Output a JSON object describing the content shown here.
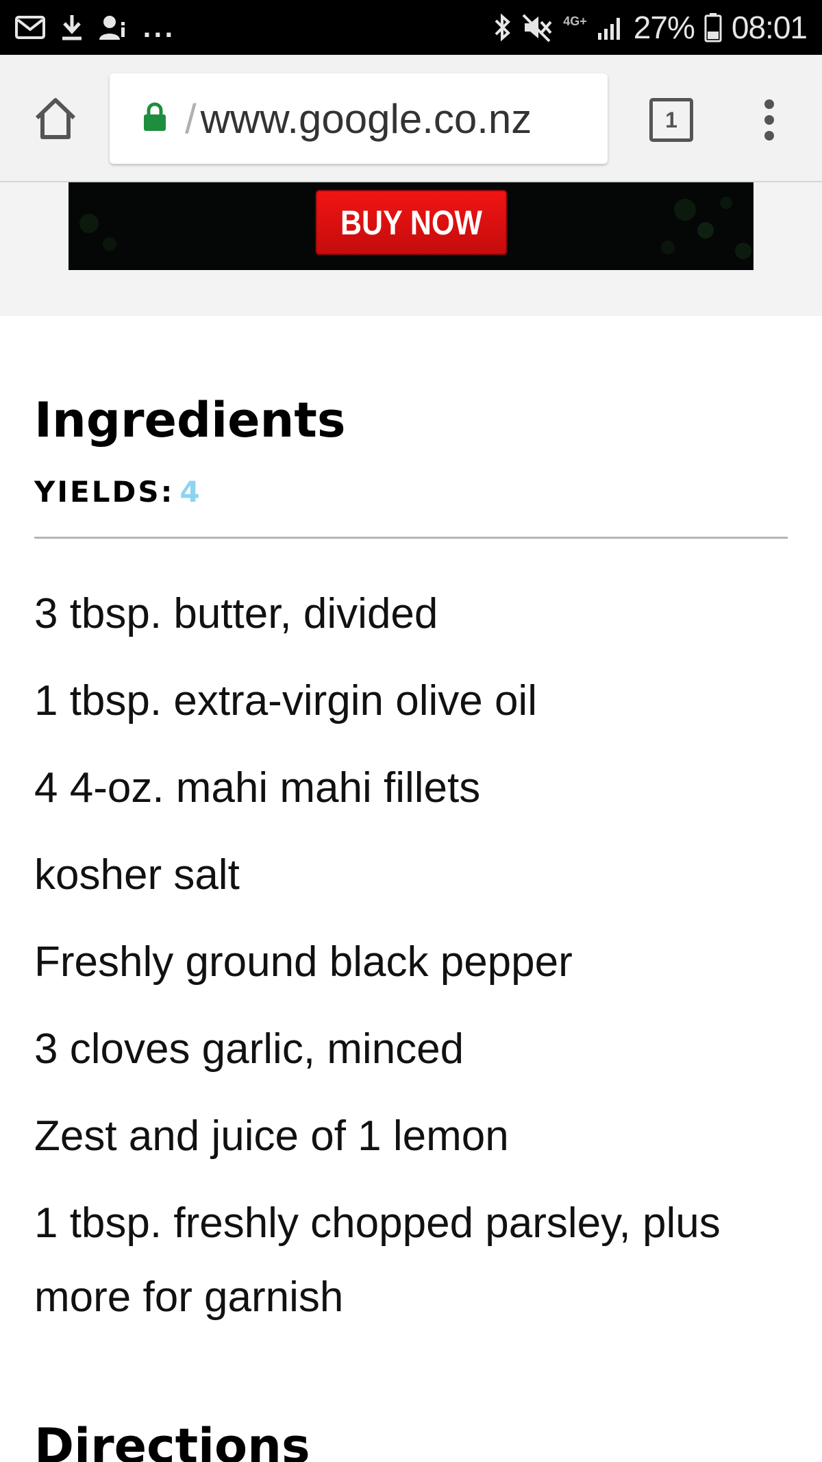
{
  "status_bar": {
    "notification_icons": [
      "mail-icon",
      "download-icon",
      "person-info-icon"
    ],
    "more_notifications": "...",
    "network_type": "4G+",
    "battery": "27%",
    "time": "08:01",
    "status_icons": [
      "bluetooth-icon",
      "mute-icon",
      "signal-icon",
      "battery-icon"
    ]
  },
  "browser": {
    "url_prefix": "/",
    "url": "www.google.co.nz",
    "tab_count": "1",
    "colors": {
      "lock": "#1e8e3e",
      "toolbar": "#f2f2f2"
    }
  },
  "ad": {
    "button_label": "BUY NOW",
    "colors": {
      "button": "#e01010",
      "banner": "#050706"
    }
  },
  "recipe": {
    "ingredients_heading": "Ingredients",
    "yields_label": "YIELDS:",
    "yields_value": "4",
    "yields_color": "#8fd4ef",
    "ingredients": [
      "3 tbsp. butter, divided",
      "1 tbsp. extra-virgin olive oil",
      "4 4-oz. mahi mahi fillets",
      "kosher salt",
      "Freshly ground black pepper",
      "3 cloves garlic, minced",
      "Zest and juice of 1 lemon",
      "1 tbsp. freshly chopped parsley, plus more for garnish"
    ],
    "directions_heading": "Directions"
  }
}
